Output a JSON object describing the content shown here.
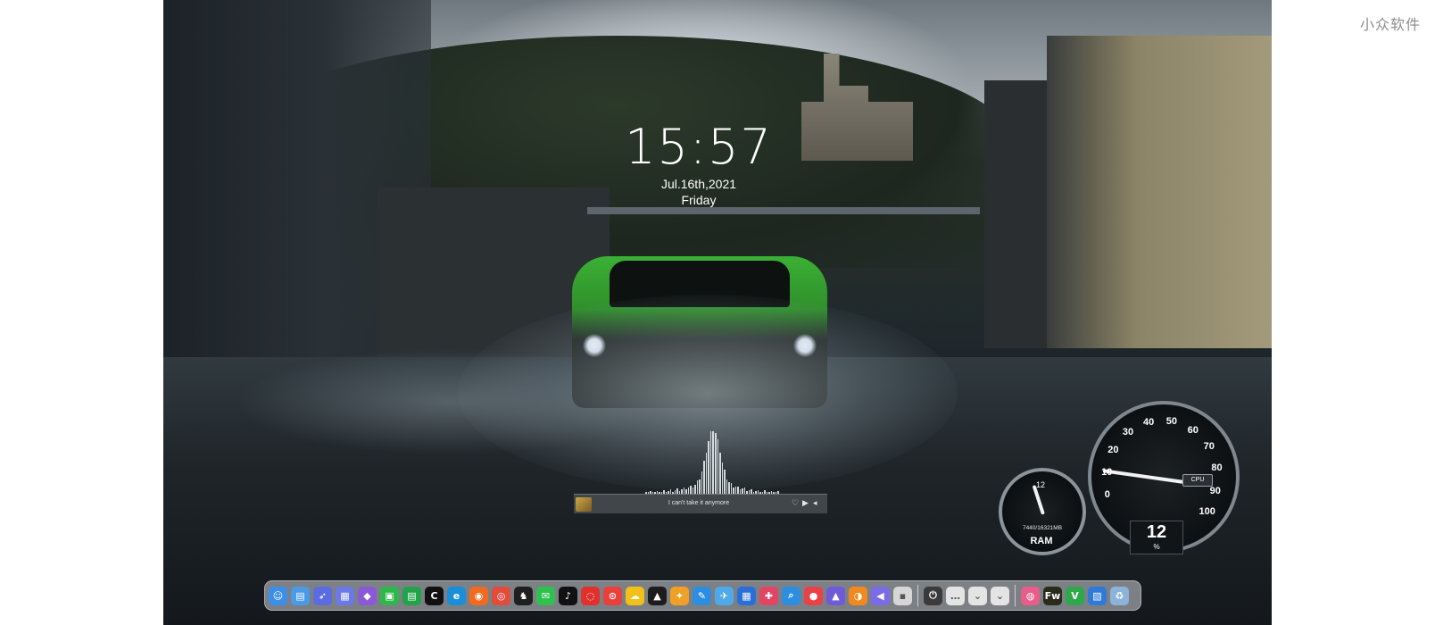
{
  "watermark": {
    "text": "小众软件"
  },
  "clock": {
    "time": "15:57",
    "date": "Jul.16th,2021",
    "day": "Friday"
  },
  "music_player": {
    "title": "I can't take it anymore",
    "controls": [
      "heart-icon",
      "play-icon",
      "volume-icon"
    ]
  },
  "ram_gauge": {
    "percent": "12",
    "memory": "7440/16321MB",
    "label": "RAM"
  },
  "cpu_gauge": {
    "ticks": [
      "0",
      "10",
      "20",
      "30",
      "40",
      "50",
      "60",
      "70",
      "80",
      "90",
      "100"
    ],
    "tag": "CPU",
    "value": "12",
    "unit": "%"
  },
  "dock": {
    "apps": [
      {
        "name": "finder-icon",
        "color": "#3b8fe8",
        "glyph": "☺"
      },
      {
        "name": "files-icon",
        "color": "#4a9ae6",
        "glyph": "▤"
      },
      {
        "name": "launchpad-icon",
        "color": "#5b6be0",
        "glyph": "➶"
      },
      {
        "name": "app-grid-icon",
        "color": "#6a78e8",
        "glyph": "▦"
      },
      {
        "name": "ai-app-icon",
        "color": "#8a5ad6",
        "glyph": "◆"
      },
      {
        "name": "wechat-store-icon",
        "color": "#2fb84a",
        "glyph": "▣"
      },
      {
        "name": "greenbox-icon",
        "color": "#22a34a",
        "glyph": "▤"
      },
      {
        "name": "c-app-icon",
        "color": "#111111",
        "glyph": "C"
      },
      {
        "name": "edge-browser-icon",
        "color": "#1a8fd8",
        "glyph": "e"
      },
      {
        "name": "firefox-icon",
        "color": "#f06a1f",
        "glyph": "◉"
      },
      {
        "name": "chrome-icon",
        "color": "#e34b3b",
        "glyph": "◎"
      },
      {
        "name": "qq-icon",
        "color": "#1f1f1f",
        "glyph": "♞"
      },
      {
        "name": "wechat-icon",
        "color": "#2ec150",
        "glyph": "✉"
      },
      {
        "name": "tiktok-icon",
        "color": "#111111",
        "glyph": "♪"
      },
      {
        "name": "netease-music-icon",
        "color": "#e0312d",
        "glyph": "◌"
      },
      {
        "name": "netease-cloud-icon",
        "color": "#e8403a",
        "glyph": "⊙"
      },
      {
        "name": "cloud-drive-icon",
        "color": "#f2c019",
        "glyph": "☁"
      },
      {
        "name": "infinity-icon",
        "color": "#1c1c1c",
        "glyph": "▲"
      },
      {
        "name": "jiguang-icon",
        "color": "#f0a024",
        "glyph": "✦"
      },
      {
        "name": "notes-icon",
        "color": "#2d8ee0",
        "glyph": "✎"
      },
      {
        "name": "bird-icon",
        "color": "#4fa8e8",
        "glyph": "✈"
      },
      {
        "name": "grid-app-icon",
        "color": "#2a6fd8",
        "glyph": "▦"
      },
      {
        "name": "puzzle-icon",
        "color": "#e24563",
        "glyph": "✚"
      },
      {
        "name": "search-app-icon",
        "color": "#2d8ee0",
        "glyph": "⌕"
      },
      {
        "name": "record-icon",
        "color": "#e84148",
        "glyph": "●"
      },
      {
        "name": "image-viewer-icon",
        "color": "#6f5ad8",
        "glyph": "▲"
      },
      {
        "name": "orange-app-icon",
        "color": "#f08a1f",
        "glyph": "◑"
      },
      {
        "name": "speaker-icon",
        "color": "#7a6ce8",
        "glyph": "◀"
      },
      {
        "name": "apps-switcher-icon",
        "color": "#d6d6d6",
        "glyph": "▪"
      },
      {
        "name": "power-icon",
        "color": "#3a3a3a",
        "glyph": "⏻"
      },
      {
        "name": "more-icon",
        "color": "#e4e4e4",
        "glyph": "…"
      },
      {
        "name": "chevron-down-icon",
        "color": "#e4e4e4",
        "glyph": "⌄"
      },
      {
        "name": "chevron-down-alt-icon",
        "color": "#e4e4e4",
        "glyph": "⌄"
      },
      {
        "name": "colorful-ball-icon",
        "color": "#e85d8a",
        "glyph": "◍"
      },
      {
        "name": "fireworks-icon",
        "color": "#2b2b1c",
        "glyph": "Fw"
      },
      {
        "name": "green-v-icon",
        "color": "#2ea84a",
        "glyph": "V"
      },
      {
        "name": "photo-icon",
        "color": "#2f7ad8",
        "glyph": "▧"
      },
      {
        "name": "trash-icon",
        "color": "#8fb3d8",
        "glyph": "♻"
      }
    ]
  }
}
